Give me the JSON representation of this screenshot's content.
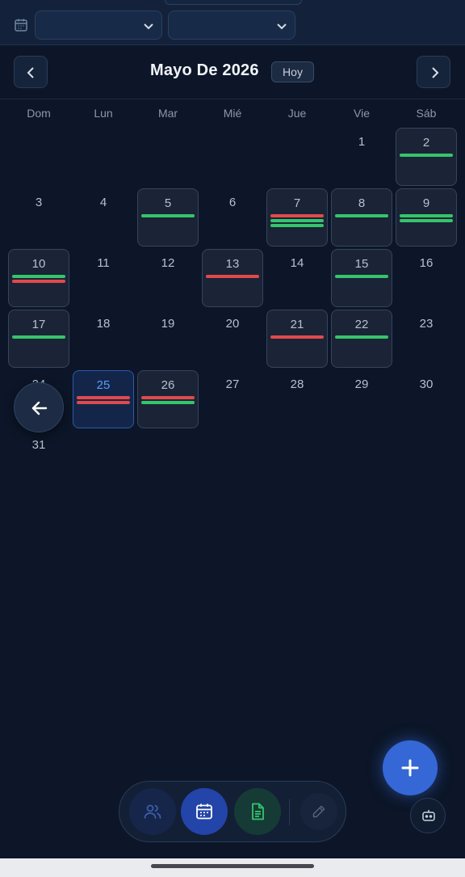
{
  "filters": {
    "icon": "calendar-icon",
    "select_1_value": "",
    "select_2_value": ""
  },
  "header": {
    "month_title": "Mayo De 2026",
    "today_label": "Hoy",
    "prev_icon": "chevron-left-icon",
    "next_icon": "chevron-right-icon"
  },
  "weekdays": [
    "Dom",
    "Lun",
    "Mar",
    "Mié",
    "Jue",
    "Vie",
    "Sáb"
  ],
  "days": [
    {
      "n": "1",
      "col": 5,
      "row": 0,
      "events": []
    },
    {
      "n": "2",
      "col": 6,
      "row": 0,
      "events": [
        "g"
      ]
    },
    {
      "n": "3",
      "col": 0,
      "row": 1,
      "events": []
    },
    {
      "n": "4",
      "col": 1,
      "row": 1,
      "events": []
    },
    {
      "n": "5",
      "col": 2,
      "row": 1,
      "events": [
        "g"
      ]
    },
    {
      "n": "6",
      "col": 3,
      "row": 1,
      "events": []
    },
    {
      "n": "7",
      "col": 4,
      "row": 1,
      "events": [
        "r",
        "g",
        "g"
      ]
    },
    {
      "n": "8",
      "col": 5,
      "row": 1,
      "events": [
        "g"
      ]
    },
    {
      "n": "9",
      "col": 6,
      "row": 1,
      "events": [
        "g",
        "g"
      ]
    },
    {
      "n": "10",
      "col": 0,
      "row": 2,
      "events": [
        "g",
        "r"
      ]
    },
    {
      "n": "11",
      "col": 1,
      "row": 2,
      "events": []
    },
    {
      "n": "12",
      "col": 2,
      "row": 2,
      "events": []
    },
    {
      "n": "13",
      "col": 3,
      "row": 2,
      "events": [
        "r"
      ]
    },
    {
      "n": "14",
      "col": 4,
      "row": 2,
      "events": []
    },
    {
      "n": "15",
      "col": 5,
      "row": 2,
      "events": [
        "g"
      ]
    },
    {
      "n": "16",
      "col": 6,
      "row": 2,
      "events": []
    },
    {
      "n": "17",
      "col": 0,
      "row": 3,
      "events": [
        "g"
      ]
    },
    {
      "n": "18",
      "col": 1,
      "row": 3,
      "events": []
    },
    {
      "n": "19",
      "col": 2,
      "row": 3,
      "events": []
    },
    {
      "n": "20",
      "col": 3,
      "row": 3,
      "events": []
    },
    {
      "n": "21",
      "col": 4,
      "row": 3,
      "events": [
        "r"
      ]
    },
    {
      "n": "22",
      "col": 5,
      "row": 3,
      "events": [
        "g"
      ]
    },
    {
      "n": "23",
      "col": 6,
      "row": 3,
      "events": []
    },
    {
      "n": "24",
      "col": 0,
      "row": 4,
      "events": []
    },
    {
      "n": "25",
      "col": 1,
      "row": 4,
      "events": [
        "r",
        "r"
      ],
      "today": true
    },
    {
      "n": "26",
      "col": 2,
      "row": 4,
      "events": [
        "r",
        "g"
      ]
    },
    {
      "n": "27",
      "col": 3,
      "row": 4,
      "events": []
    },
    {
      "n": "28",
      "col": 4,
      "row": 4,
      "events": []
    },
    {
      "n": "29",
      "col": 5,
      "row": 4,
      "events": []
    },
    {
      "n": "30",
      "col": 6,
      "row": 4,
      "events": []
    },
    {
      "n": "31",
      "col": 0,
      "row": 5,
      "events": []
    }
  ],
  "colors": {
    "background": "#0c1628",
    "event_green": "#36c46c",
    "event_red": "#e2494d",
    "today_accent": "#5d9bf5",
    "fab": "#3568d6"
  },
  "floating": {
    "back_icon": "arrow-left-icon",
    "fab_icon": "plus-icon",
    "bot_icon": "robot-icon"
  },
  "dock": {
    "items": [
      {
        "icon": "users-icon",
        "active": false
      },
      {
        "icon": "calendar-icon",
        "active": true
      },
      {
        "icon": "document-icon",
        "active": false
      },
      {
        "icon": "pencil-icon",
        "active": false
      }
    ]
  }
}
